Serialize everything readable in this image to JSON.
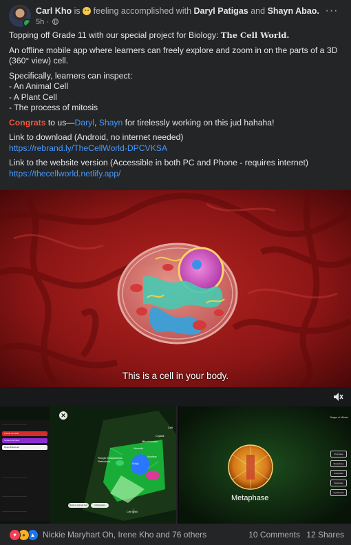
{
  "post": {
    "author": "Carl Kho",
    "is_word": "is",
    "feeling": "feeling accomplished with",
    "tagged_1": "Daryl Patigas",
    "and_word": "and",
    "tagged_2": "Shayn Abao.",
    "time": "5h ·",
    "more_label": "···"
  },
  "text": {
    "p1_prefix": "Topping off Grade 11 with our special project for Biology:",
    "p1_brand": "The Cell World.",
    "p2": "An offline mobile app where learners can freely explore and zoom in on the parts of a 3D (360° view) cell.",
    "p3_intro": "Specifically, learners can inspect:",
    "p3_items": [
      "- An Animal Cell",
      "- A Plant Cell",
      "- The process of mitosis"
    ],
    "congrats": "Congrats",
    "congrats_mid": " to us—",
    "mention_1": "Daryl",
    "comma": ", ",
    "mention_2": "Shayn",
    "congrats_tail": " for tirelessly working on this jud hahaha!",
    "download_label": "Link to download (Android, no internet needed)",
    "download_link": "https://rebrand.ly/TheCellWorld-DPCVKSA",
    "web_label": "Link to the website version (Accessible in both PC and Phone - requires internet)",
    "web_link": "https://thecellworld.netlify.app/"
  },
  "video": {
    "subtitle": "This is a cell in your body."
  },
  "thumb_left": {
    "close": "✕",
    "menu_buttons": [
      "Animal Cell A/B",
      "Nucleus Window",
      "Rock Milestones"
    ],
    "labels": [
      "Cell",
      "Crystal",
      "Mitochondria",
      "Vacuole",
      "Nuclear",
      "Rough Endoplasmic Reticulum",
      "Golgi",
      "Cell Wall"
    ],
    "pills": [
      "Back to Animal Cell",
      "Chloroplast"
    ]
  },
  "thumb_right": {
    "stage_label": "Metaphase",
    "stage_list_title": "Stages of Mitosis",
    "stages": [
      "Prophase",
      "Metaphase",
      "Anaphase",
      "Telophase",
      "Cytokinesis"
    ]
  },
  "footer": {
    "reactors": "Nickie Maryhart Oh, Irene Kho and 76 others",
    "comments": "10 Comments",
    "shares": "12 Shares"
  },
  "colors": {
    "background": "#242526",
    "link": "#4599ff",
    "congrats": "#f5533d",
    "secondary_text": "#b0b3b8"
  }
}
